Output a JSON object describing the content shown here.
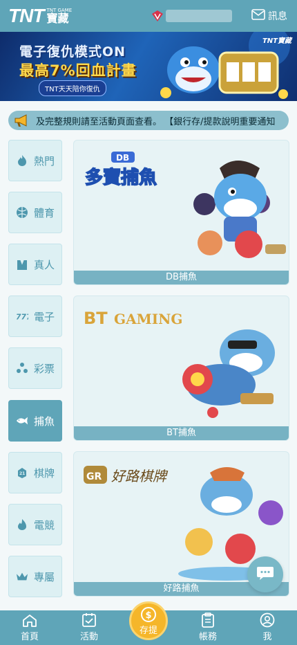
{
  "header": {
    "logo_main": "TNT",
    "logo_sub": "TNT GAME",
    "logo_cn": "寶藏",
    "message_label": "訊息"
  },
  "banner": {
    "line1": "電子復仇模式ON",
    "line2": "最高7%回血計畫",
    "pill": "TNT天天陪你復仇",
    "brand": "TNT寶藏"
  },
  "marquee": {
    "text": "及完整規則請至活動頁面查看。 【銀行存/提款說明重要通知"
  },
  "sidebar": {
    "items": [
      {
        "label": "熱門",
        "icon": "fire-icon"
      },
      {
        "label": "體育",
        "icon": "ball-icon"
      },
      {
        "label": "真人",
        "icon": "dealer-icon"
      },
      {
        "label": "電子",
        "icon": "slot-777-icon"
      },
      {
        "label": "彩票",
        "icon": "lottery-balls-icon"
      },
      {
        "label": "捕魚",
        "icon": "fish-icon"
      },
      {
        "label": "棋牌",
        "icon": "chess-icon"
      },
      {
        "label": "電競",
        "icon": "flame-esports-icon"
      },
      {
        "label": "專屬",
        "icon": "crown-icon"
      }
    ],
    "active_index": 5
  },
  "games": [
    {
      "label": "DB捕魚",
      "logo_text": "多寶捕魚",
      "logo_small": "DB"
    },
    {
      "label": "BT捕魚",
      "logo_text": "GAMING",
      "logo_small": "BT"
    },
    {
      "label": "好路捕魚",
      "logo_text": "好路棋牌",
      "logo_small": "GR"
    }
  ],
  "bottom_nav": {
    "home": "首頁",
    "activity": "活動",
    "deposit": "存提",
    "account": "帳務",
    "me": "我"
  },
  "colors": {
    "primary": "#5fa5b8",
    "sidebar_bg": "#ddf0f3",
    "card_bg": "#e7f3f5",
    "deposit": "#f5b62a"
  }
}
